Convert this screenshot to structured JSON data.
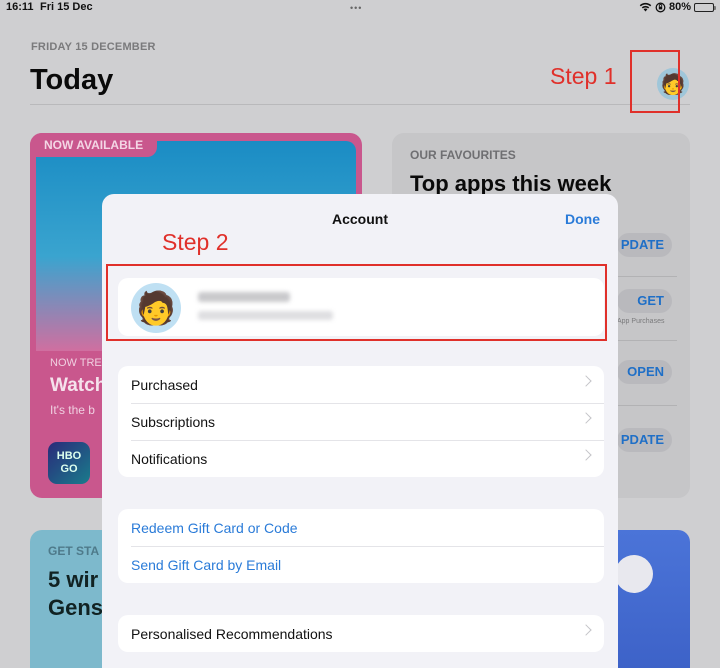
{
  "status_bar": {
    "time": "16:11",
    "date": "Fri 15 Dec",
    "dots": "•••",
    "battery_percent": "80%",
    "battery_level": 0.8,
    "icons": [
      "wifi-icon",
      "orientation-lock-icon",
      "battery-icon"
    ]
  },
  "header": {
    "date_label": "FRIDAY 15 DECEMBER",
    "title": "Today",
    "avatar_emoji": "🧑"
  },
  "annotations": {
    "step1": "Step 1",
    "step2": "Step 2",
    "color": "#e0302a"
  },
  "cards": {
    "left": {
      "tag": "NOW AVAILABLE",
      "kicker": "NOW TRE",
      "headline": "Watch",
      "description": "It's the b",
      "app_icon_text_1": "HBO",
      "app_icon_text_2": "GO"
    },
    "right": {
      "kicker": "OUR FAVOURITES",
      "headline": "Top apps this week",
      "buttons": [
        "PDATE",
        "GET",
        "OPEN",
        "PDATE"
      ],
      "get_subtext": "App Purchases"
    },
    "bottom_left": {
      "kicker": "GET STA",
      "headline_1": "5 wir",
      "headline_2": "Gens"
    }
  },
  "modal": {
    "title": "Account",
    "done_label": "Done",
    "accent": "#2a7bd8",
    "account": {
      "avatar_emoji": "🧑",
      "name": "(blurred)",
      "email": "(blurred)"
    },
    "group1": [
      {
        "label": "Purchased"
      },
      {
        "label": "Subscriptions"
      },
      {
        "label": "Notifications"
      }
    ],
    "group2": [
      {
        "label": "Redeem Gift Card or Code"
      },
      {
        "label": "Send Gift Card by Email"
      }
    ],
    "group3": [
      {
        "label": "Personalised Recommendations"
      }
    ]
  }
}
